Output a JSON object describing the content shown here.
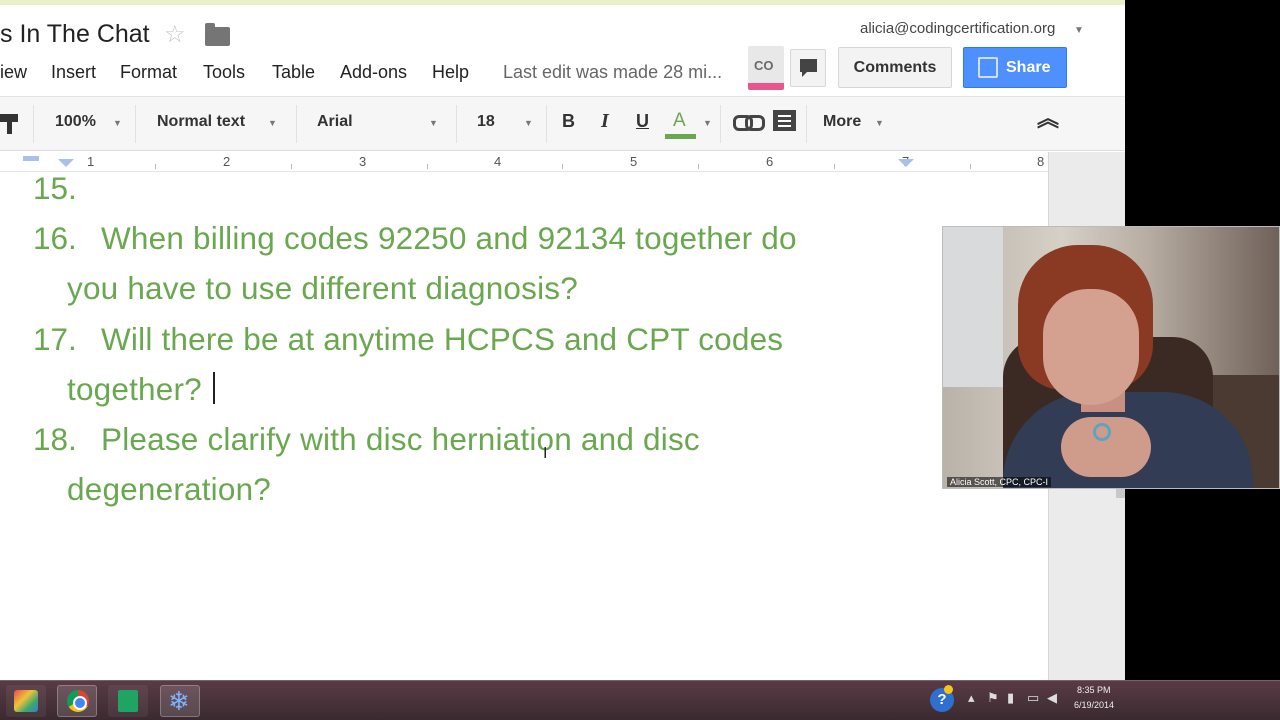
{
  "document": {
    "title": "s In The Chat",
    "account": "alicia@codingcertification.org",
    "last_edit": "Last edit was made 28 mi..."
  },
  "menu": [
    "iew",
    "Insert",
    "Format",
    "Tools",
    "Table",
    "Add-ons",
    "Help"
  ],
  "header_buttons": {
    "comments": "Comments",
    "share": "Share",
    "presence_initials": "CO"
  },
  "toolbar": {
    "zoom": "100%",
    "style": "Normal text",
    "font": "Arial",
    "size": "18",
    "bold": "B",
    "italic": "I",
    "underline": "U",
    "text_color": "A",
    "more": "More"
  },
  "ruler": {
    "numbers": [
      "1",
      "2",
      "3",
      "4",
      "5",
      "6",
      "7",
      "8"
    ]
  },
  "questions": [
    {
      "num": "15.",
      "lines": [
        ""
      ]
    },
    {
      "num": "16.",
      "lines": [
        "When billing codes 92250 and 92134 together do",
        "you have to use different diagnosis?"
      ]
    },
    {
      "num": "17.",
      "lines": [
        "Will there be at anytime HCPCS and CPT codes",
        "together?"
      ]
    },
    {
      "num": "18.",
      "lines": [
        "Please clarify with disc herniation and disc",
        "degeneration?"
      ]
    }
  ],
  "webcam": {
    "caption": "Alicia Scott, CPC, CPC-I"
  },
  "taskbar": {
    "time": "8:35 PM",
    "date": "6/19/2014"
  },
  "colors": {
    "doc_text": "#6aa84f",
    "share_blue": "#4d90fe",
    "taskbar": "#4a3038"
  }
}
